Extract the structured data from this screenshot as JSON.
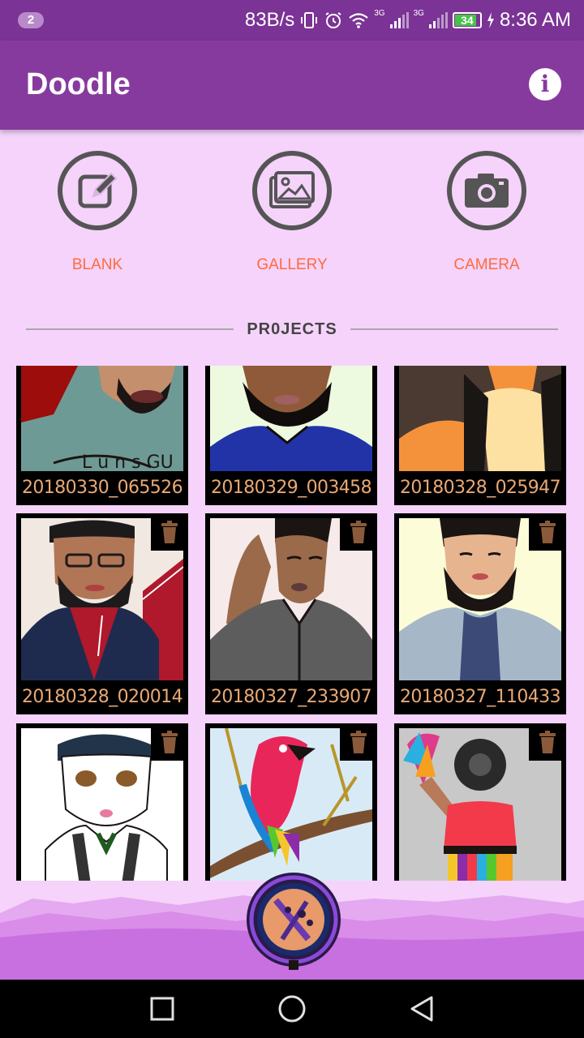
{
  "status_bar": {
    "notification_count": "2",
    "net_speed": "83B/s",
    "network_a": "3G",
    "network_b": "3G",
    "battery": "34",
    "time": "8:36 AM"
  },
  "app_bar": {
    "title": "Doodle",
    "info_icon": "info-icon"
  },
  "actions": [
    {
      "label": "BLANK",
      "icon": "edit-icon"
    },
    {
      "label": "GALLERY",
      "icon": "image-icon"
    },
    {
      "label": "CAMERA",
      "icon": "camera-icon"
    }
  ],
  "projects": {
    "heading": "PR0JECTS",
    "items": [
      {
        "name": "20180330_065526"
      },
      {
        "name": "20180329_003458"
      },
      {
        "name": "20180328_025947"
      },
      {
        "name": "20180328_020014"
      },
      {
        "name": "20180327_233907"
      },
      {
        "name": "20180327_110433"
      }
    ]
  },
  "colors": {
    "primary": "#873a9e",
    "status_bar": "#7b3395",
    "background": "#f5d3fb",
    "accent": "#ff6b3d",
    "caption": "#e9a874"
  }
}
